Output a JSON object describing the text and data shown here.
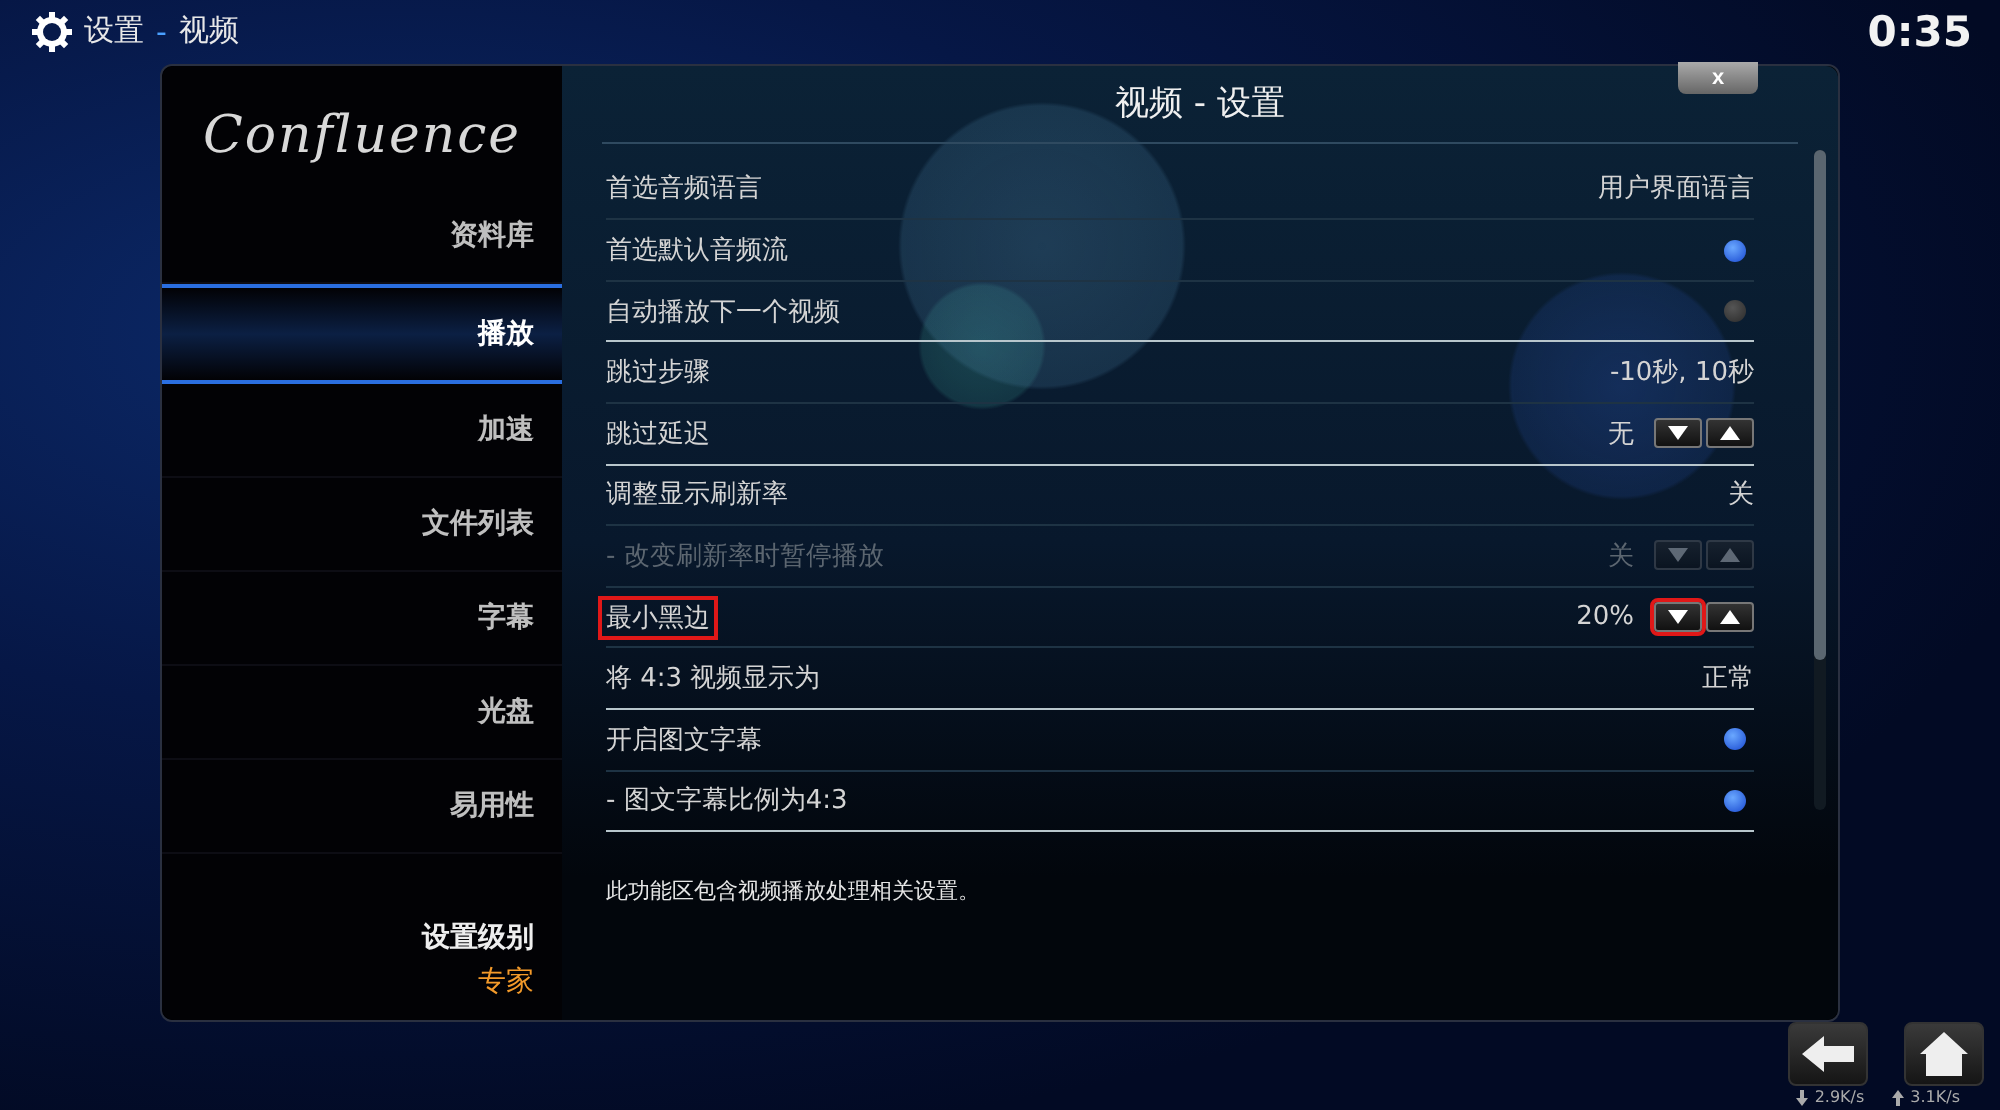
{
  "header": {
    "section": "设置",
    "separator": "-",
    "page": "视频",
    "clock": "0:35"
  },
  "sidebar": {
    "logo": "Confluence",
    "items": [
      {
        "label": "资料库",
        "selected": false
      },
      {
        "label": "播放",
        "selected": true
      },
      {
        "label": "加速",
        "selected": false
      },
      {
        "label": "文件列表",
        "selected": false
      },
      {
        "label": "字幕",
        "selected": false
      },
      {
        "label": "光盘",
        "selected": false
      },
      {
        "label": "易用性",
        "selected": false
      }
    ],
    "level_label": "设置级别",
    "level_value": "专家"
  },
  "dialog": {
    "title": "视频 - 设置",
    "close": "x",
    "rows": [
      {
        "kind": "value",
        "label": "首选音频语言",
        "value": "用户界面语言",
        "disabled": false,
        "highlighted": false
      },
      {
        "kind": "toggle",
        "label": "首选默认音频流",
        "on": true,
        "disabled": false,
        "highlighted": false
      },
      {
        "kind": "toggle",
        "label": "自动播放下一个视频",
        "on": false,
        "disabled": false,
        "highlighted": false
      },
      {
        "kind": "value",
        "label": "跳过步骤",
        "value": "-10秒, 10秒",
        "disabled": false,
        "highlighted": false
      },
      {
        "kind": "spinner",
        "label": "跳过延迟",
        "value": "无",
        "disabled": false,
        "highlighted": false
      },
      {
        "kind": "value",
        "label": "调整显示刷新率",
        "value": "关",
        "disabled": false,
        "highlighted": false
      },
      {
        "kind": "spinner",
        "label": "- 改变刷新率时暂停播放",
        "value": "关",
        "disabled": true,
        "highlighted": false
      },
      {
        "kind": "spinner",
        "label": "最小黑边",
        "value": "20%",
        "disabled": false,
        "highlighted": true
      },
      {
        "kind": "value",
        "label": "将 4:3 视频显示为",
        "value": "正常",
        "disabled": false,
        "highlighted": false
      },
      {
        "kind": "toggle",
        "label": "开启图文字幕",
        "on": true,
        "disabled": false,
        "highlighted": false
      },
      {
        "kind": "toggle",
        "label": "- 图文字幕比例为4:3",
        "on": true,
        "disabled": false,
        "highlighted": false
      }
    ],
    "description": "此功能区包含视频播放处理相关设置。"
  },
  "status": {
    "download": "2.9K/s",
    "upload": "3.1K/s"
  }
}
